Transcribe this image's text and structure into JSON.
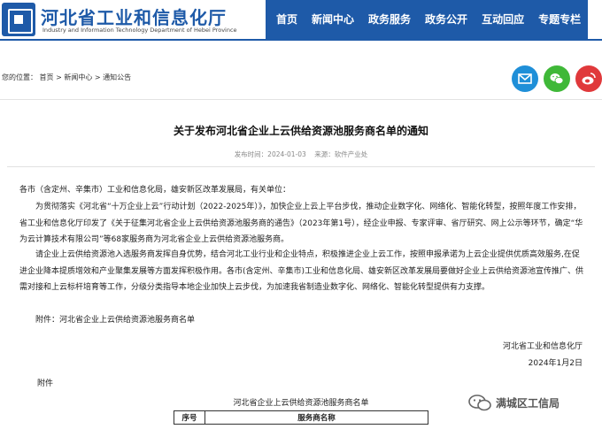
{
  "header": {
    "site_title": "河北省工业和信息化厅",
    "site_subtitle": "Industry and Information Technology Department of Hebei Province",
    "nav": [
      "首页",
      "新闻中心",
      "政务服务",
      "政务公开",
      "互动回应",
      "专题专栏"
    ]
  },
  "breadcrumb": {
    "prefix": "您的位置：",
    "items": [
      "首页",
      "新闻中心",
      "通知公告"
    ],
    "separator": ">"
  },
  "share": {
    "icons": [
      "mail-icon",
      "wechat-icon",
      "weibo-icon"
    ],
    "colors": {
      "mail": "#1f8fd8",
      "wechat": "#3fb838",
      "weibo": "#e0393b"
    }
  },
  "article": {
    "title": "关于发布河北省企业上云供给资源池服务商名单的通知",
    "meta": "发布时间：2024-01-03    来源：软件产业处",
    "salutation": "各市（含定州、辛集市）工业和信息化局，雄安新区改革发展局，有关单位：",
    "para1": "为贯彻落实《河北省“十万企业上云”行动计划（2022-2025年）》，加快企业上云上平台步伐，推动企业数字化、网络化、智能化转型，按照年度工作安排，省工业和信息化厅印发了《关于征集河北省企业上云供给资源池服务商的通告》（2023年第1号），经企业申报、专家评审、省厅研究、网上公示等环节，确定“华为云计算技术有限公司”等68家服务商为河北省企业上云供给资源池服务商。",
    "para2": "请企业上云供给资源池入选服务商发挥自身优势，结合河北工业行业和企业特点，积极推进企业上云工作，按照申报承诺为上云企业提供优质高效服务,在促进企业降本提质增效和产业聚集发展等方面发挥积极作用。各市(含定州、辛集市)工业和信息化局、雄安新区改革发展局要做好企业上云供给资源池宣传推广、供需对接和上云标杆培育等工作，分级分类指导本地企业加快上云步伐，为加速我省制造业数字化、网络化、智能化转型提供有力支撑。",
    "attachment_line": "附件：河北省企业上云供给资源池服务商名单",
    "signature_org": "河北省工业和信息化厅",
    "signature_date": "2024年1月2日",
    "attachment_label": "附件",
    "table_title": "河北省企业上云供给资源池服务商名单",
    "table_headers": [
      "序号",
      "服务商名称"
    ]
  },
  "watermark": {
    "text": "满城区工信局"
  }
}
